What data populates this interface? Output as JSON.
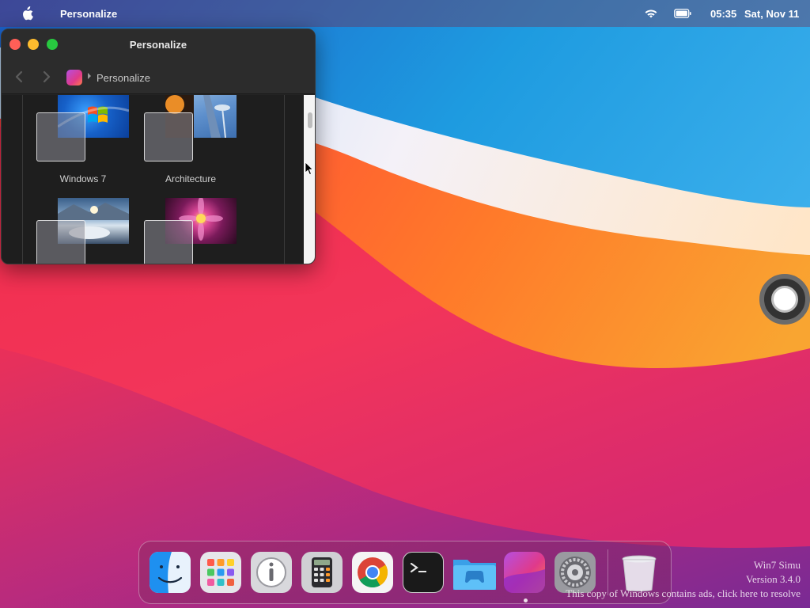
{
  "menubar": {
    "app_name": "Personalize",
    "time": "05:35",
    "date": "Sat, Nov 11",
    "icons": [
      "apple-icon",
      "wifi-icon",
      "battery-icon"
    ]
  },
  "window": {
    "title": "Personalize",
    "breadcrumb_label": "Personalize",
    "controls": [
      "close",
      "minimize",
      "maximize"
    ],
    "themes": [
      {
        "label": "Windows 7"
      },
      {
        "label": "Architecture"
      },
      {
        "label": ""
      },
      {
        "label": ""
      }
    ]
  },
  "dock": {
    "items": [
      {
        "name": "Finder",
        "icon": "finder-icon"
      },
      {
        "name": "Launchpad",
        "icon": "launchpad-icon"
      },
      {
        "name": "About",
        "icon": "info-icon"
      },
      {
        "name": "Calculator",
        "icon": "calculator-icon"
      },
      {
        "name": "Chrome",
        "icon": "chrome-icon"
      },
      {
        "name": "Terminal",
        "icon": "terminal-icon"
      },
      {
        "name": "Games",
        "icon": "game-folder-icon"
      },
      {
        "name": "Personalize",
        "icon": "personalize-icon"
      },
      {
        "name": "System Preferences",
        "icon": "settings-icon"
      },
      {
        "name": "Trash",
        "icon": "trash-icon"
      }
    ],
    "active": "Personalize"
  },
  "watermark": {
    "line1": "Win7 Simu",
    "line2": "Version 3.4.0",
    "line3": "This copy of Windows contains ads, click here to resolve"
  },
  "colors": {
    "close": "#ff5f57",
    "minimize": "#febc2e",
    "maximize": "#28c840"
  }
}
